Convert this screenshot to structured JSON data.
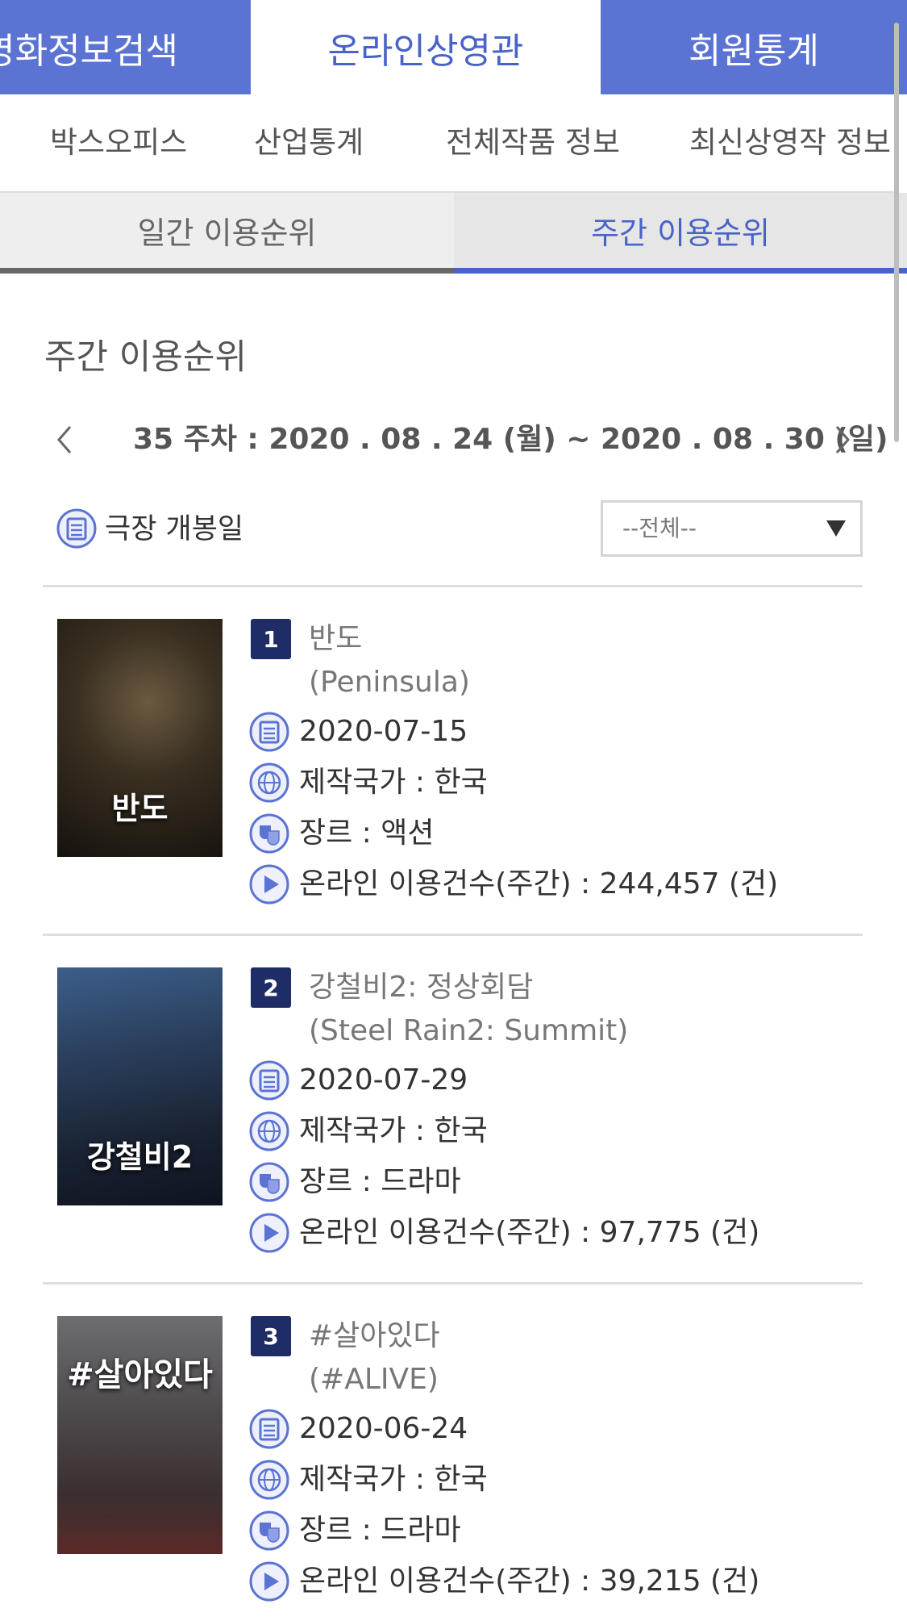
{
  "top_tabs": [
    {
      "label": "영화정보검색"
    },
    {
      "label": "온라인상영관"
    },
    {
      "label": "회원통계"
    }
  ],
  "sub_nav": [
    {
      "label": "박스오피스"
    },
    {
      "label": "산업통계"
    },
    {
      "label": "전체작품 정보"
    },
    {
      "label": "최신상영작 정보"
    }
  ],
  "rank_tabs": {
    "daily": "일간 이용순위",
    "weekly": "주간 이용순위",
    "active": "weekly"
  },
  "section_title": "주간 이용순위",
  "week_nav": {
    "prev_icon": "chevron-left-icon",
    "label": "35 주차 : 2020 . 08 . 24 (월) ~ 2020 . 08 . 30 (일)",
    "next_icon": "chevron-right-icon"
  },
  "filter": {
    "label": "극장 개봉일",
    "select_value": "--전체--"
  },
  "movies": [
    {
      "rank": "1",
      "title": "반도",
      "eng_title": "(Peninsula)",
      "poster_text": "반도",
      "release_date": "2020-07-15",
      "country": "제작국가 : 한국",
      "genre": "장르 : 액션",
      "views": "온라인 이용건수(주간) : 244,457 (건)"
    },
    {
      "rank": "2",
      "title": "강철비2: 정상회담",
      "eng_title": "(Steel Rain2: Summit)",
      "poster_text": "강철비2",
      "release_date": "2020-07-29",
      "country": "제작국가 : 한국",
      "genre": "장르 : 드라마",
      "views": "온라인 이용건수(주간) : 97,775 (건)"
    },
    {
      "rank": "3",
      "title": "#살아있다",
      "eng_title": "(#ALIVE)",
      "poster_text": "#살아있다",
      "release_date": "2020-06-24",
      "country": "제작국가 : 한국",
      "genre": "장르 : 드라마",
      "views": "온라인 이용건수(주간) : 39,215 (건)"
    }
  ],
  "colors": {
    "brand": "#5b73d3",
    "accent_text": "#4a63c8",
    "rank_badge": "#1e2d66"
  }
}
